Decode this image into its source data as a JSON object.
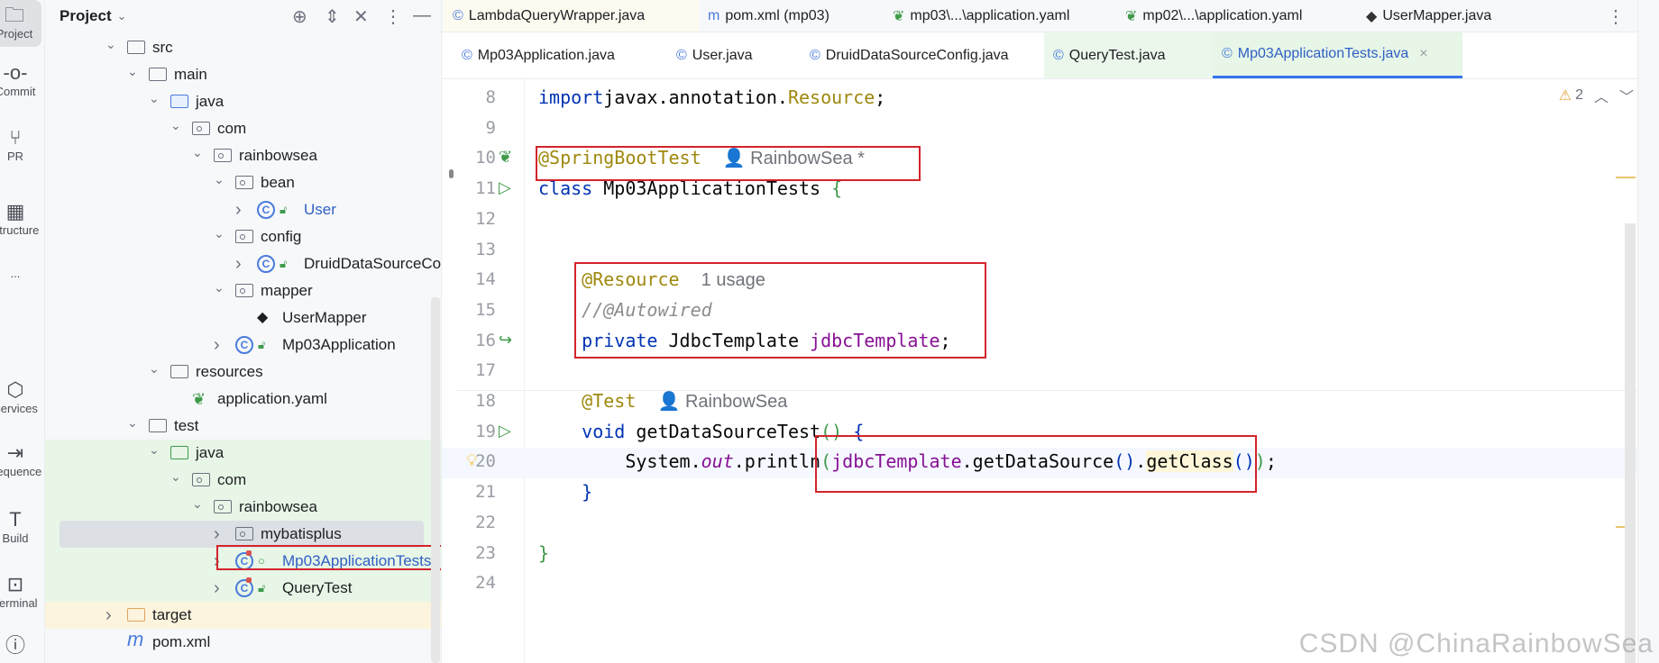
{
  "left_strip": [
    {
      "label": "Project",
      "icon": "folder-icon",
      "selected": true
    },
    {
      "label": "Commit",
      "icon": "commit-icon"
    },
    {
      "label": "PR",
      "icon": "pull-request-icon"
    },
    {
      "label": "Structure",
      "icon": "structure-icon"
    },
    {
      "label": "...",
      "icon": "more-icon"
    },
    {
      "label": "Services",
      "icon": "services-icon"
    },
    {
      "label": "Sequence",
      "icon": "sequence-icon"
    },
    {
      "label": "Build",
      "icon": "hammer-icon"
    },
    {
      "label": "Terminal",
      "icon": "terminal-icon"
    },
    {
      "label": "",
      "icon": "problems-icon"
    }
  ],
  "project_panel": {
    "title": "Project",
    "tree": [
      {
        "label": "src",
        "depth": 0,
        "chev": "down",
        "icon": "folder"
      },
      {
        "label": "main",
        "depth": 1,
        "chev": "down",
        "icon": "folder"
      },
      {
        "label": "java",
        "depth": 2,
        "chev": "down",
        "icon": "source-folder"
      },
      {
        "label": "com",
        "depth": 3,
        "chev": "down",
        "icon": "package"
      },
      {
        "label": "rainbowsea",
        "depth": 4,
        "chev": "down",
        "icon": "package"
      },
      {
        "label": "bean",
        "depth": 5,
        "chev": "down",
        "icon": "package"
      },
      {
        "label": "User",
        "depth": 6,
        "chev": "right",
        "icon": "class",
        "blue": true
      },
      {
        "label": "config",
        "depth": 5,
        "chev": "down",
        "icon": "package"
      },
      {
        "label": "DruidDataSourceConfig",
        "depth": 6,
        "chev": "right",
        "icon": "class"
      },
      {
        "label": "mapper",
        "depth": 5,
        "chev": "down",
        "icon": "package"
      },
      {
        "label": "UserMapper",
        "depth": 6,
        "chev": "",
        "icon": "mybatis"
      },
      {
        "label": "Mp03Application",
        "depth": 5,
        "chev": "right",
        "icon": "spring-class"
      },
      {
        "label": "resources",
        "depth": 2,
        "chev": "down",
        "icon": "resources-folder"
      },
      {
        "label": "application.yaml",
        "depth": 3,
        "chev": "",
        "icon": "yaml"
      },
      {
        "label": "test",
        "depth": 1,
        "chev": "down",
        "icon": "folder"
      },
      {
        "label": "java",
        "depth": 2,
        "chev": "down",
        "icon": "test-folder"
      },
      {
        "label": "com",
        "depth": 3,
        "chev": "down",
        "icon": "package"
      },
      {
        "label": "rainbowsea",
        "depth": 4,
        "chev": "down",
        "icon": "package"
      },
      {
        "label": "mybatisplus",
        "depth": 5,
        "chev": "right",
        "icon": "package",
        "selected": true
      },
      {
        "label": "Mp03ApplicationTests",
        "depth": 5,
        "chev": "right",
        "icon": "test-class",
        "blue": true
      },
      {
        "label": "QueryTest",
        "depth": 5,
        "chev": "right",
        "icon": "test-class"
      },
      {
        "label": "target",
        "depth": 0,
        "chev": "right",
        "icon": "excluded-folder"
      },
      {
        "label": "pom.xml",
        "depth": 0,
        "chev": "",
        "icon": "maven"
      }
    ]
  },
  "tabs_row1": [
    {
      "label": "LambdaQueryWrapper.java",
      "icon": "class-icon",
      "glyph": "©"
    },
    {
      "label": "pom.xml (mp03)",
      "icon": "maven-icon",
      "glyph": "m"
    },
    {
      "label": "mp03\\...\\application.yaml",
      "icon": "spring-icon",
      "glyph": "❦"
    },
    {
      "label": "mp02\\...\\application.yaml",
      "icon": "spring-icon",
      "glyph": "❦"
    },
    {
      "label": "UserMapper.java",
      "icon": "mybatis-icon",
      "glyph": "◆"
    }
  ],
  "tabs_row2": [
    {
      "label": "Mp03Application.java",
      "icon": "spring-class-icon",
      "glyph": "©"
    },
    {
      "label": "User.java",
      "icon": "class-icon",
      "glyph": "©"
    },
    {
      "label": "DruidDataSourceConfig.java",
      "icon": "class-icon",
      "glyph": "©"
    },
    {
      "label": "QueryTest.java",
      "icon": "test-class-icon",
      "glyph": "©"
    },
    {
      "label": "Mp03ApplicationTests.java",
      "icon": "test-class-icon",
      "glyph": "©",
      "active": true
    }
  ],
  "editor": {
    "warnings": "2",
    "line_numbers": [
      "8",
      "9",
      "10",
      "11",
      "12",
      "13",
      "14",
      "15",
      "16",
      "17",
      "18",
      "19",
      "20",
      "21",
      "22",
      "23",
      "24"
    ],
    "lines": [
      [
        [
          "kw",
          "import"
        ],
        [
          "",
          "javax.annotation."
        ],
        [
          "ann",
          "Resource"
        ],
        [
          "",
          ";"
        ]
      ],
      [],
      [
        [
          "ann",
          "@SpringBootTest"
        ],
        [
          "",
          "  "
        ],
        [
          "hint",
          "👤 RainbowSea *"
        ]
      ],
      [
        [
          "kw",
          "class"
        ],
        [
          "",
          " Mp03ApplicationTests "
        ],
        [
          "br",
          "{"
        ]
      ],
      [],
      [],
      [
        [
          "",
          "    "
        ],
        [
          "ann",
          "@Resource"
        ],
        [
          "",
          "  "
        ],
        [
          "hint",
          "1 usage"
        ]
      ],
      [
        [
          "",
          "    "
        ],
        [
          "cm",
          "//@Autowired"
        ]
      ],
      [
        [
          "",
          "    "
        ],
        [
          "kw",
          "private"
        ],
        [
          "",
          " JdbcTemplate "
        ],
        [
          "fld",
          "jdbcTemplate"
        ],
        [
          "",
          ";"
        ]
      ],
      [],
      [
        [
          "",
          "    "
        ],
        [
          "ann",
          "@Test"
        ],
        [
          "",
          "  "
        ],
        [
          "hint",
          "👤 RainbowSea"
        ]
      ],
      [
        [
          "",
          "    "
        ],
        [
          "kw",
          "void"
        ],
        [
          "",
          " getDataSourceTest"
        ],
        [
          "br",
          "()"
        ],
        [
          "",
          " "
        ],
        [
          "bb",
          "{"
        ]
      ],
      [
        [
          "",
          "        System."
        ],
        [
          "it",
          "out"
        ],
        [
          "",
          ".println"
        ],
        [
          "br",
          "("
        ],
        [
          "fld",
          "jdbcTemplate"
        ],
        [
          "",
          ".getDataSource"
        ],
        [
          "bb",
          "()"
        ],
        [
          "",
          "."
        ],
        [
          "hl",
          "getClass"
        ],
        [
          "bb",
          "()"
        ],
        [
          "br",
          ")"
        ],
        [
          "",
          ";"
        ]
      ],
      [
        [
          "",
          "    "
        ],
        [
          "bb",
          "}"
        ]
      ],
      [],
      [
        [
          "br",
          "}"
        ]
      ],
      []
    ]
  },
  "watermark": "CSDN @ChinaRainbowSea"
}
